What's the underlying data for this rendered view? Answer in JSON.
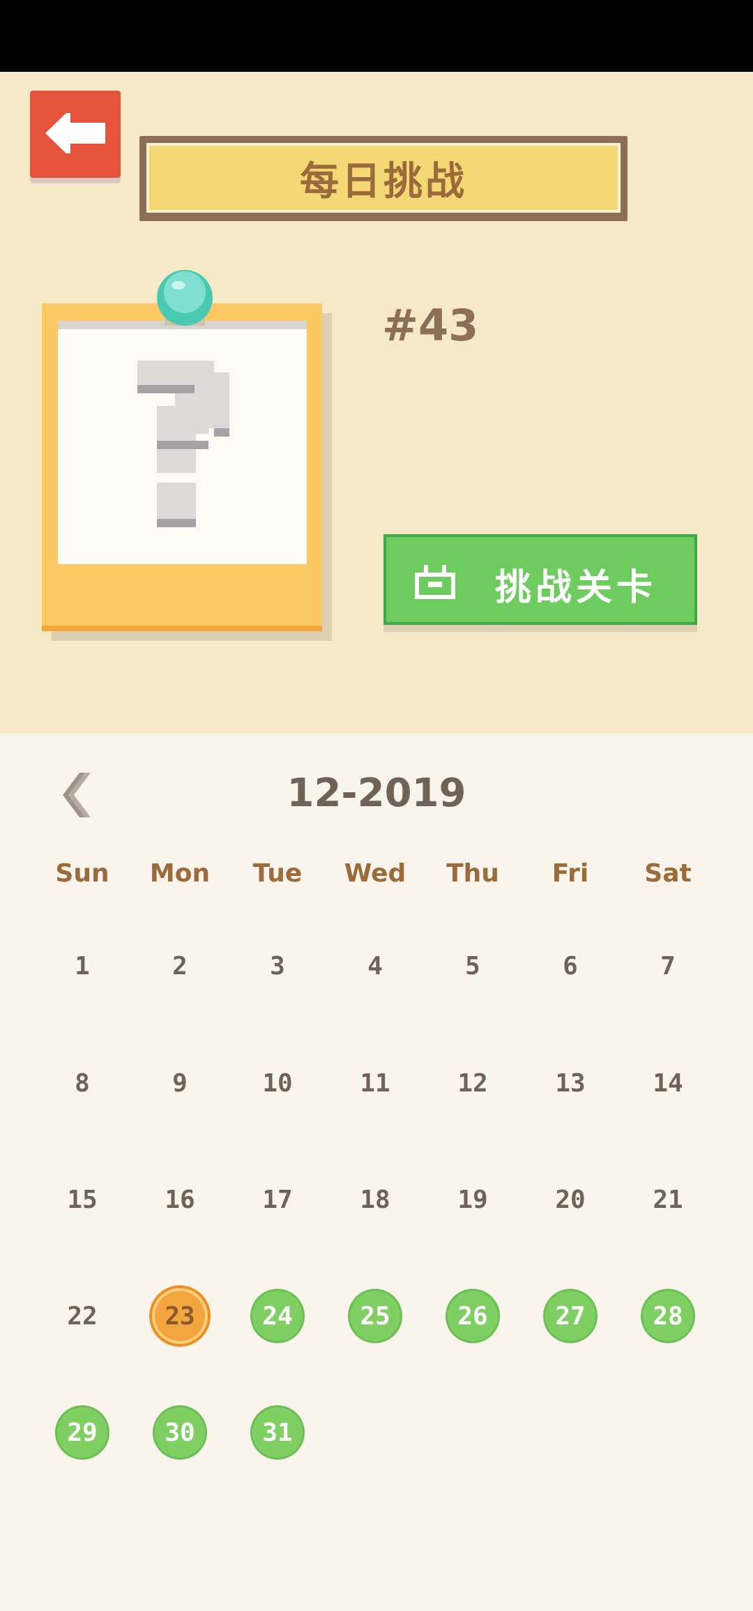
{
  "header": {
    "title": "每日挑战"
  },
  "puzzle": {
    "level_number": "#43",
    "challenge_button_label": "挑战关卡",
    "icons": {
      "back": "arrow-left-icon",
      "pin": "pin-icon",
      "preview": "question-mark-icon",
      "ad": "tv-icon"
    }
  },
  "calendar": {
    "month_label": "12-2019",
    "weekdays": [
      "Sun",
      "Mon",
      "Tue",
      "Wed",
      "Thu",
      "Fri",
      "Sat"
    ],
    "first_weekday_index": 0,
    "days_in_month": 31,
    "today": 23,
    "completed_days": [
      24,
      25,
      26,
      27,
      28,
      29,
      30,
      31
    ]
  },
  "colors": {
    "accent_red": "#e5533c",
    "accent_green": "#6dcc5d",
    "accent_orange": "#f3a540",
    "text_brown": "#9b6b3c",
    "text_gray": "#6f6257"
  }
}
